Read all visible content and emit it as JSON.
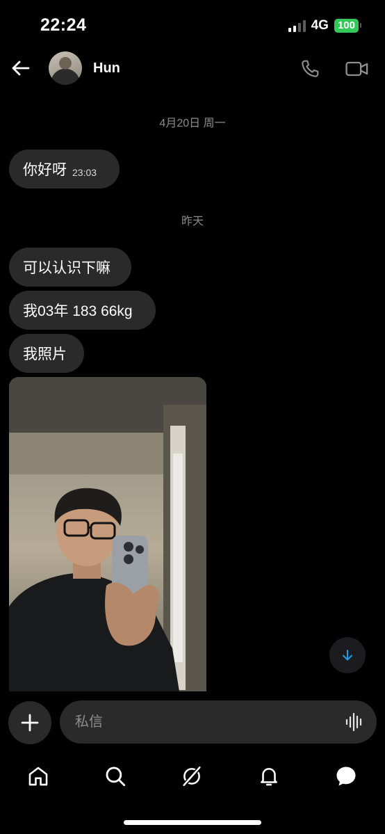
{
  "status_bar": {
    "time": "22:24",
    "network": "4G",
    "battery": "100",
    "battery_color": "#34c759"
  },
  "header": {
    "contact_name": "Hun",
    "back_icon": "arrow-left-icon",
    "call_icon": "phone-icon",
    "video_icon": "video-camera-icon"
  },
  "messages": {
    "date_1": "4月20日 周一",
    "msg_1_text": "你好呀",
    "msg_1_time": "23:03",
    "date_2": "昨天",
    "msg_2_text": "可以认识下嘛",
    "msg_3_text": "我03年 183 66kg",
    "msg_4_text": "我照片"
  },
  "composer": {
    "placeholder": "私信",
    "add_icon": "plus-icon",
    "voice_icon": "voice-waveform-icon"
  },
  "scroll_down_icon": "arrow-down-icon",
  "bottom_nav": [
    {
      "icon": "home-icon"
    },
    {
      "icon": "search-icon"
    },
    {
      "icon": "grok-icon"
    },
    {
      "icon": "bell-icon"
    },
    {
      "icon": "messages-icon"
    }
  ],
  "colors": {
    "background": "#000000",
    "bubble": "#2a2a2a",
    "accent": "#1d9bf0"
  }
}
